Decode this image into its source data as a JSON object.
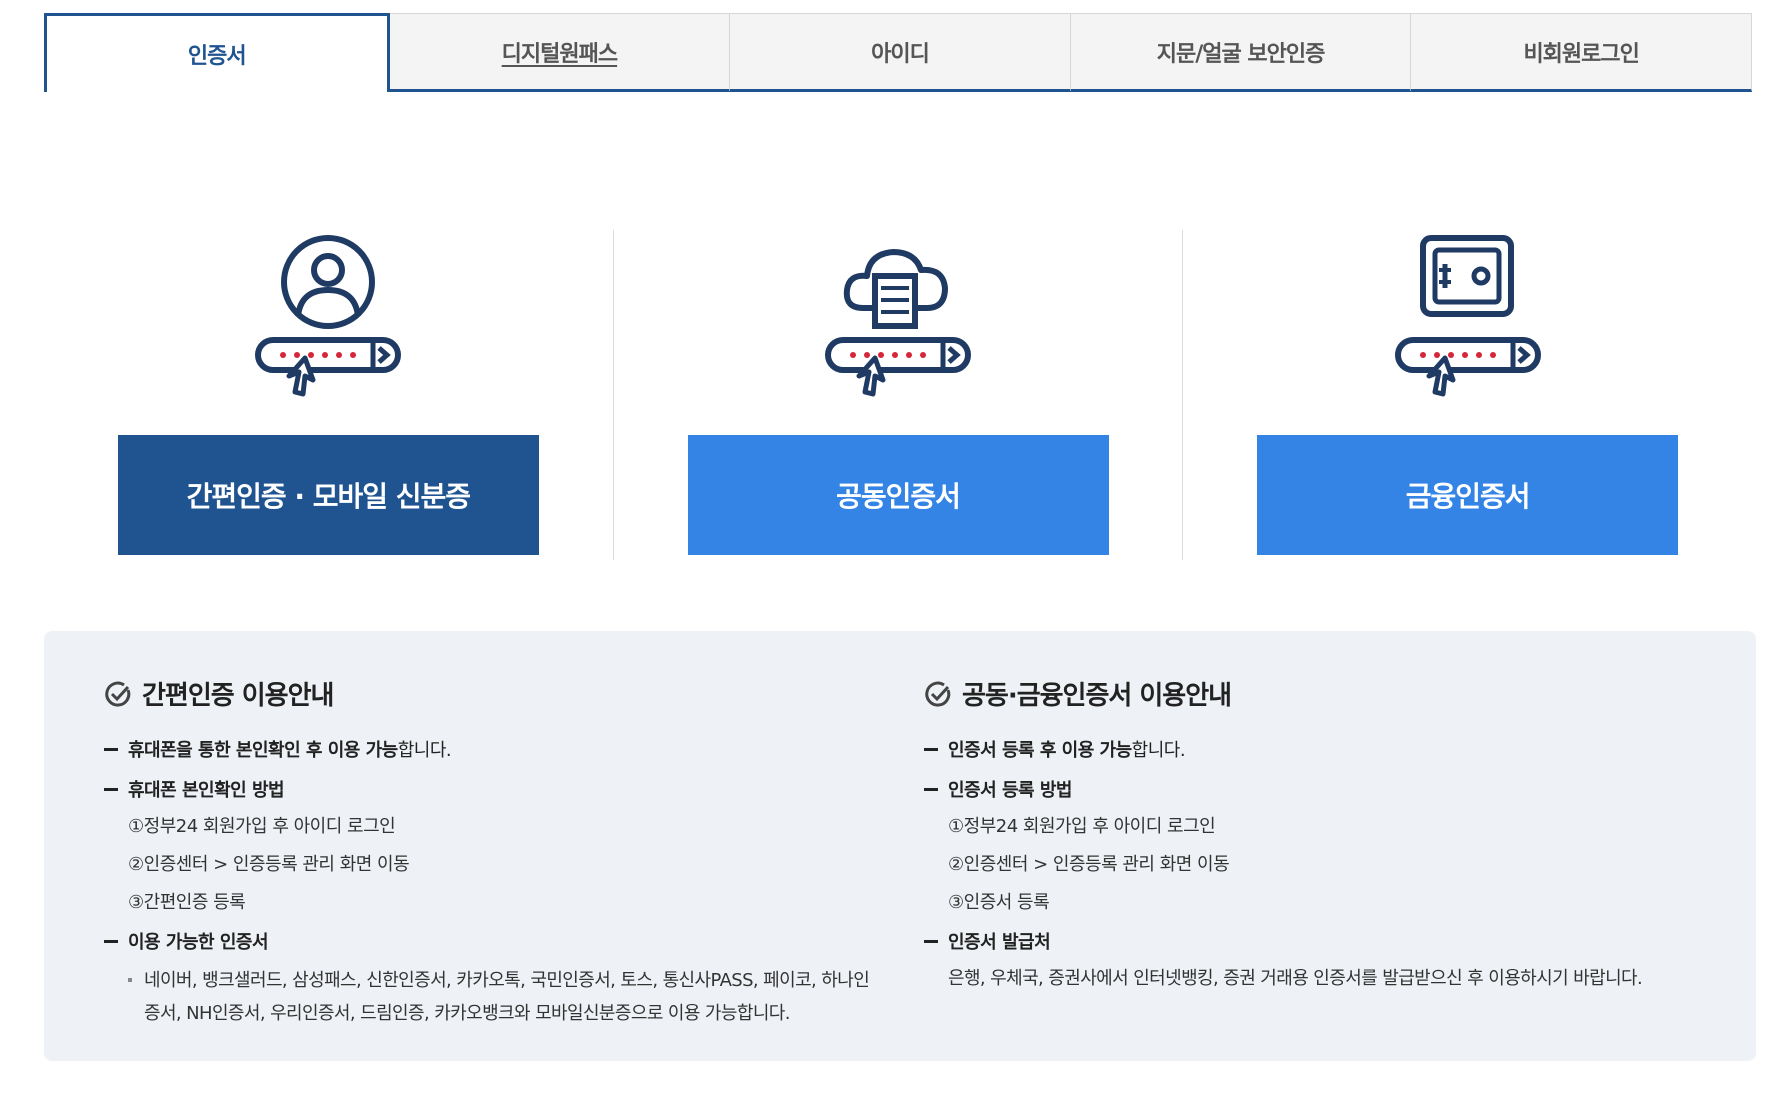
{
  "tabs": [
    {
      "label": "인증서",
      "active": true
    },
    {
      "label": "디지털원패스",
      "active": false
    },
    {
      "label": "아이디",
      "active": false
    },
    {
      "label": "지문/얼굴 보안인증",
      "active": false
    },
    {
      "label": "비회원로그인",
      "active": false
    }
  ],
  "cards": [
    {
      "icon": "user-password-icon",
      "button_label": "간편인증 · 모바일 신분증",
      "color": "#1f5491"
    },
    {
      "icon": "cloud-password-icon",
      "button_label": "공동인증서",
      "color": "#3384e5"
    },
    {
      "icon": "safe-password-icon",
      "button_label": "금융인증서",
      "color": "#3384e5"
    }
  ],
  "info": {
    "left": {
      "title": "간편인증 이용안내",
      "b1_strong": "휴대폰을 통한 본인확인 후 이용 가능",
      "b1_rest": "합니다.",
      "b2_strong": "휴대폰 본인확인 방법",
      "steps": [
        "①정부24 회원가입 후 아이디 로그인",
        "②인증센터 > 인증등록 관리 화면 이동",
        "③간편인증 등록"
      ],
      "b3_strong": "이용 가능한 인증서",
      "note": "네이버, 뱅크샐러드, 삼성패스, 신한인증서, 카카오톡, 국민인증서, 토스, 통신사PASS, 페이코, 하나인증서, NH인증서, 우리인증서, 드림인증, 카카오뱅크와 모바일신분증으로 이용 가능합니다."
    },
    "right": {
      "title": "공동·금융인증서 이용안내",
      "b1_strong": "인증서 등록 후 이용 가능",
      "b1_rest": "합니다.",
      "b2_strong": "인증서 등록 방법",
      "steps": [
        "①정부24 회원가입 후 아이디 로그인",
        "②인증센터 > 인증등록 관리 화면 이동",
        "③인증서 등록"
      ],
      "b3_strong": "인증서 발급처",
      "note": "은행, 우체국, 증권사에서 인터넷뱅킹, 증권 거래용 인증서를 발급받으신 후 이용하시기 바랍니다."
    }
  },
  "colors": {
    "accent_dark": "#1f5491",
    "accent_blue": "#3384e5",
    "password_dots": "#d6263a"
  }
}
